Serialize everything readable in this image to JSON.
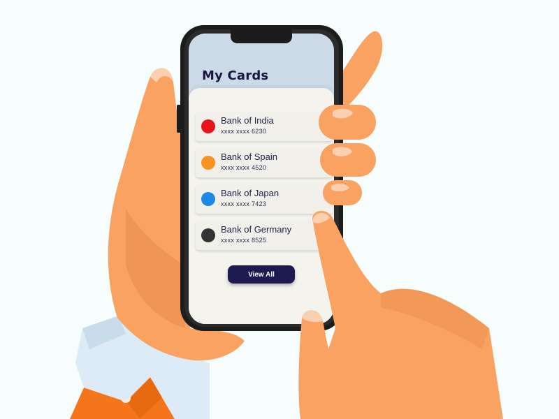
{
  "screen": {
    "title": "My Cards",
    "cards": [
      {
        "bank": "Bank of India",
        "number": "xxxx xxxx 6230",
        "color": "#e8141b"
      },
      {
        "bank": "Bank of Spain",
        "number": "xxxx xxxx 4520",
        "color": "#f7931e"
      },
      {
        "bank": "Bank of Japan",
        "number": "xxxx xxxx 7423",
        "color": "#1e88e5"
      },
      {
        "bank": "Bank of Germany",
        "number": "xxxx xxxx 8525",
        "color": "#333333"
      }
    ],
    "view_all_label": "View All"
  },
  "colors": {
    "background": "#f7fdfc",
    "skin": "#f9a262",
    "skin_shade": "#ea8d4b",
    "phone_body": "#1c1c1c",
    "screen_bg": "#ccd9e6",
    "sheet_bg": "#f4f3ee",
    "button": "#1d1a4f",
    "sleeve": "#dcebf5",
    "jacket": "#f5761a"
  }
}
